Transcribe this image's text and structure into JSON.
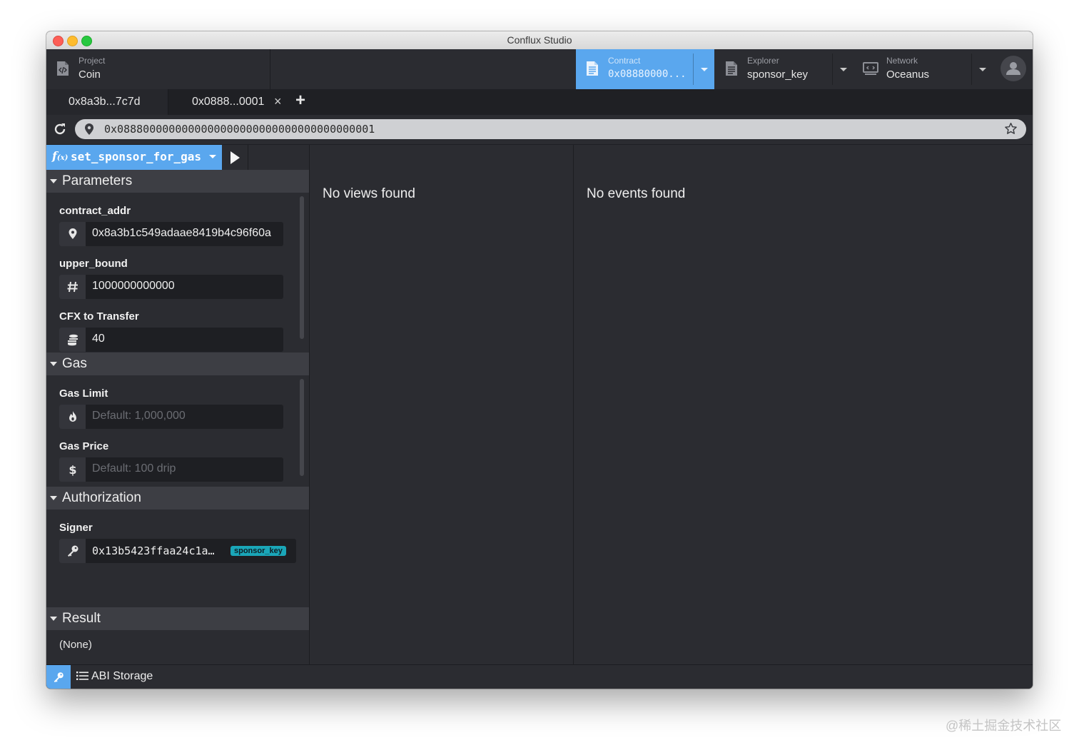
{
  "app": {
    "title": "Conflux Studio"
  },
  "header": {
    "project": {
      "caption": "Project",
      "value": "Coin"
    },
    "contract": {
      "caption": "Contract",
      "value": "0x08880000..."
    },
    "explorer": {
      "caption": "Explorer",
      "value": "sponsor_key"
    },
    "network": {
      "caption": "Network",
      "value": "Oceanus"
    }
  },
  "tabs": [
    {
      "label": "0x8a3b...7c7d"
    },
    {
      "label": "0x0888...0001",
      "close": "×"
    }
  ],
  "tab_add": "+",
  "address": {
    "value": "0x0888000000000000000000000000000000000001"
  },
  "function": {
    "name": "set_sponsor_for_gas",
    "prefix": "f",
    "prefix_sub": "(x)"
  },
  "sections": {
    "parameters": "Parameters",
    "gas": "Gas",
    "authorization": "Authorization",
    "result": "Result"
  },
  "params": [
    {
      "label": "contract_addr",
      "value": "0x8a3b1c549adaae8419b4c96f60a",
      "icon": "map-pin-icon"
    },
    {
      "label": "upper_bound",
      "value": "1000000000000",
      "icon": "hash-icon"
    },
    {
      "label": "CFX to Transfer",
      "value": "40",
      "icon": "coins-icon"
    }
  ],
  "gas": [
    {
      "label": "Gas Limit",
      "placeholder": "Default: 1,000,000",
      "icon": "flame-icon"
    },
    {
      "label": "Gas Price",
      "placeholder": "Default: 100 drip",
      "icon": "dollar-icon"
    }
  ],
  "authorization": {
    "label": "Signer",
    "value": "0x13b5423ffaa24c1a…",
    "badge": "sponsor_key",
    "icon": "key-icon"
  },
  "result": {
    "value": "(None)"
  },
  "views": {
    "empty": "No views found"
  },
  "events": {
    "empty": "No events found"
  },
  "footer": {
    "abi_storage": "ABI Storage"
  },
  "watermark": "@稀土掘金技术社区",
  "colors": {
    "accent": "#5aa7ee",
    "background": "#2b2c31",
    "badge": "#1aa6b8"
  }
}
